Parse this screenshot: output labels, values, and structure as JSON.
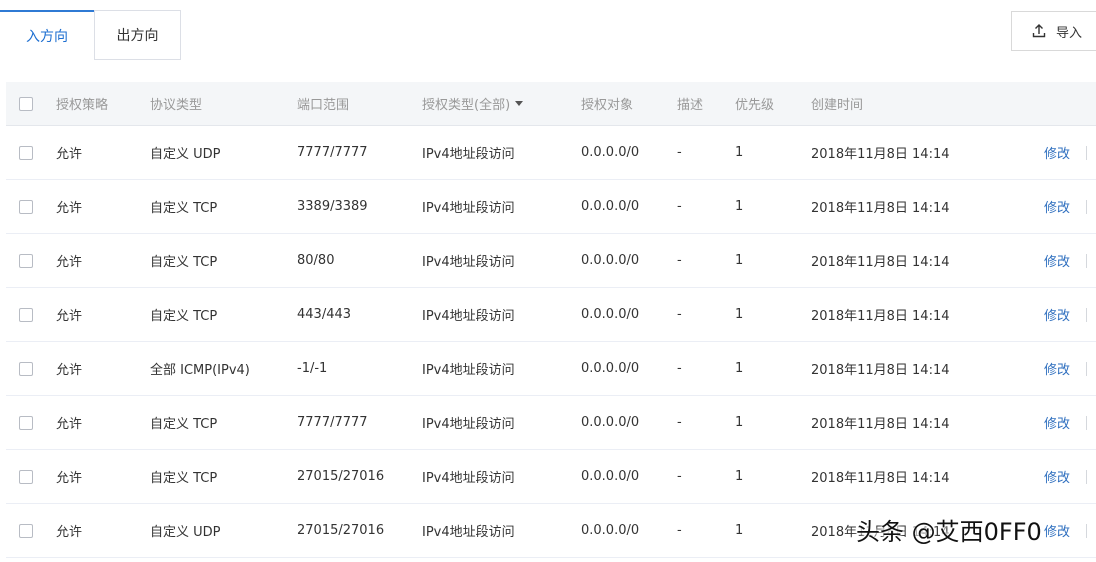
{
  "tabs": {
    "inbound": "入方向",
    "outbound": "出方向"
  },
  "toolbar": {
    "import_label": "导入",
    "import_icon": "upload-icon"
  },
  "table": {
    "columns": {
      "policy": "授权策略",
      "protocol": "协议类型",
      "port_range": "端口范围",
      "auth_type": "授权类型(全部)",
      "auth_object": "授权对象",
      "description": "描述",
      "priority": "优先级",
      "created": "创建时间"
    },
    "rows": [
      {
        "policy": "允许",
        "protocol": "自定义 UDP",
        "port_range": "7777/7777",
        "auth_type": "IPv4地址段访问",
        "auth_object": "0.0.0.0/0",
        "description": "-",
        "priority": "1",
        "created": "2018年11月8日 14:14",
        "action": "修改"
      },
      {
        "policy": "允许",
        "protocol": "自定义 TCP",
        "port_range": "3389/3389",
        "auth_type": "IPv4地址段访问",
        "auth_object": "0.0.0.0/0",
        "description": "-",
        "priority": "1",
        "created": "2018年11月8日 14:14",
        "action": "修改"
      },
      {
        "policy": "允许",
        "protocol": "自定义 TCP",
        "port_range": "80/80",
        "auth_type": "IPv4地址段访问",
        "auth_object": "0.0.0.0/0",
        "description": "-",
        "priority": "1",
        "created": "2018年11月8日 14:14",
        "action": "修改"
      },
      {
        "policy": "允许",
        "protocol": "自定义 TCP",
        "port_range": "443/443",
        "auth_type": "IPv4地址段访问",
        "auth_object": "0.0.0.0/0",
        "description": "-",
        "priority": "1",
        "created": "2018年11月8日 14:14",
        "action": "修改"
      },
      {
        "policy": "允许",
        "protocol": "全部 ICMP(IPv4)",
        "port_range": "-1/-1",
        "auth_type": "IPv4地址段访问",
        "auth_object": "0.0.0.0/0",
        "description": "-",
        "priority": "1",
        "created": "2018年11月8日 14:14",
        "action": "修改"
      },
      {
        "policy": "允许",
        "protocol": "自定义 TCP",
        "port_range": "7777/7777",
        "auth_type": "IPv4地址段访问",
        "auth_object": "0.0.0.0/0",
        "description": "-",
        "priority": "1",
        "created": "2018年11月8日 14:14",
        "action": "修改"
      },
      {
        "policy": "允许",
        "protocol": "自定义 TCP",
        "port_range": "27015/27016",
        "auth_type": "IPv4地址段访问",
        "auth_object": "0.0.0.0/0",
        "description": "-",
        "priority": "1",
        "created": "2018年11月8日 14:14",
        "action": "修改"
      },
      {
        "policy": "允许",
        "protocol": "自定义 UDP",
        "port_range": "27015/27016",
        "auth_type": "IPv4地址段访问",
        "auth_object": "0.0.0.0/0",
        "description": "-",
        "priority": "1",
        "created": "2018年11月8日 14:14",
        "action": "修改"
      }
    ]
  },
  "watermark": "头条 @艾西0FF0",
  "colors": {
    "accent": "#1e6fd1",
    "link": "#2f6fbf",
    "header_bg": "#f4f6f8"
  }
}
